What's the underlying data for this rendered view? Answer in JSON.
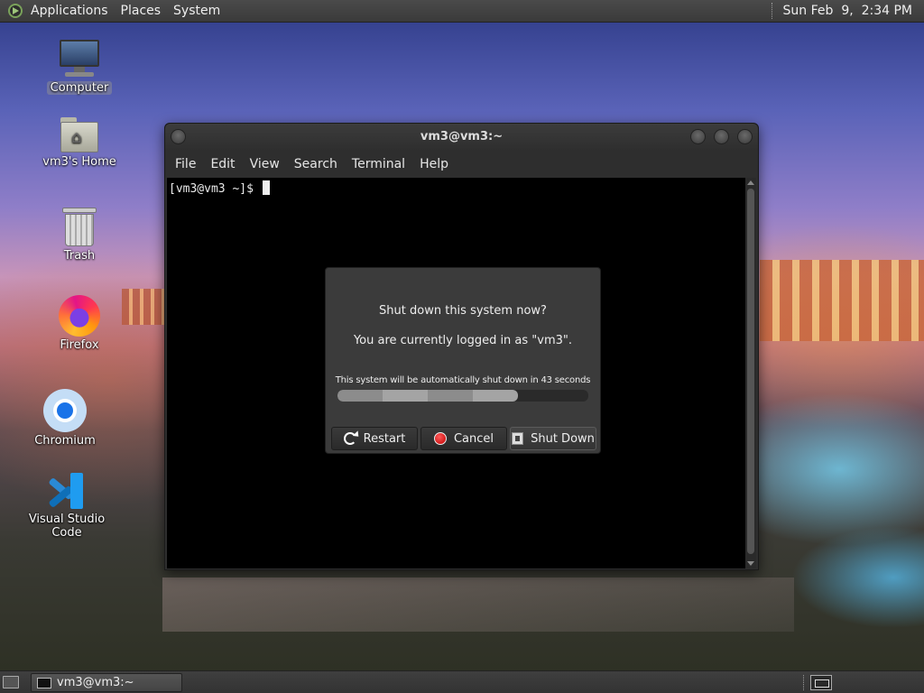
{
  "top_panel": {
    "menus": [
      "Applications",
      "Places",
      "System"
    ],
    "clock": "Sun Feb  9,  2:34 PM"
  },
  "desktop_icons": {
    "computer": "Computer",
    "home": "vm3's Home",
    "trash": "Trash",
    "firefox": "Firefox",
    "chromium": "Chromium",
    "vscode": "Visual Studio Code"
  },
  "terminal": {
    "title": "vm3@vm3:~",
    "menus": [
      "File",
      "Edit",
      "View",
      "Search",
      "Terminal",
      "Help"
    ],
    "prompt": "[vm3@vm3 ~]$ "
  },
  "dialog": {
    "question": "Shut down this system now?",
    "info": "You are currently logged in as \"vm3\".",
    "timer": "This system will be automatically shut down in 43 seconds",
    "progress_fraction": 0.72,
    "buttons": {
      "restart": "Restart",
      "cancel": "Cancel",
      "shutdown": "Shut Down"
    }
  },
  "bottom_panel": {
    "task_label": "vm3@vm3:~"
  },
  "icons": {
    "app_menu": "gnome-foot-icon",
    "restart": "restart-icon",
    "cancel": "cancel-icon",
    "shutdown": "shutdown-icon"
  }
}
